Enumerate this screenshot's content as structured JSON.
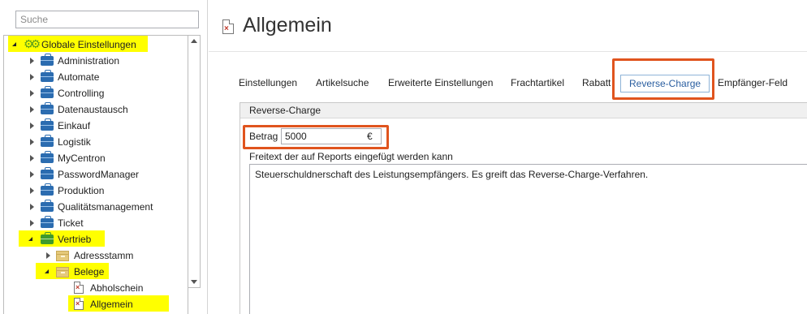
{
  "search": {
    "placeholder": "Suche"
  },
  "tree": {
    "root": {
      "label": "Globale Einstellungen",
      "icon": "gears-icon"
    },
    "items": [
      {
        "label": "Administration",
        "icon": "briefcase-icon"
      },
      {
        "label": "Automate",
        "icon": "briefcase-icon"
      },
      {
        "label": "Controlling",
        "icon": "briefcase-icon"
      },
      {
        "label": "Datenaustausch",
        "icon": "briefcase-icon"
      },
      {
        "label": "Einkauf",
        "icon": "briefcase-icon"
      },
      {
        "label": "Logistik",
        "icon": "briefcase-icon"
      },
      {
        "label": "MyCentron",
        "icon": "briefcase-icon"
      },
      {
        "label": "PasswordManager",
        "icon": "briefcase-icon"
      },
      {
        "label": "Produktion",
        "icon": "briefcase-icon"
      },
      {
        "label": "Qualitätsmanagement",
        "icon": "briefcase-icon"
      },
      {
        "label": "Ticket",
        "icon": "briefcase-icon"
      },
      {
        "label": "Vertrieb",
        "icon": "briefcase-icon"
      }
    ],
    "vertrieb_children": [
      {
        "label": "Adressstamm",
        "icon": "box-icon"
      },
      {
        "label": "Belege",
        "icon": "box-icon"
      }
    ],
    "belege_children": [
      {
        "label": "Abholschein",
        "icon": "document-icon"
      },
      {
        "label": "Allgemein",
        "icon": "document-icon"
      }
    ],
    "highlight_color": "#ffff00"
  },
  "page": {
    "title": "Allgemein"
  },
  "tabs": [
    {
      "label": "Einstellungen"
    },
    {
      "label": "Artikelsuche"
    },
    {
      "label": "Erweiterte Einstellungen"
    },
    {
      "label": "Frachtartikel"
    },
    {
      "label": "Rabatt"
    },
    {
      "label": "Reverse-Charge",
      "active": true
    },
    {
      "label": "Empfänger-Feld"
    }
  ],
  "section": {
    "header": "Reverse-Charge",
    "betrag_label": "Betrag",
    "betrag_value": "5000",
    "currency": "€",
    "freitext_label": "Freitext der auf Reports eingefügt werden kann",
    "freitext_value": "Steuerschuldnerschaft des Leistungsempfängers. Es greift das Reverse-Charge-Verfahren."
  },
  "colors": {
    "annotation": "#e0541e",
    "active_tab_border": "#8fb4d8",
    "accent_blue": "#2b6cb0",
    "accent_green": "#3f9a2e"
  }
}
